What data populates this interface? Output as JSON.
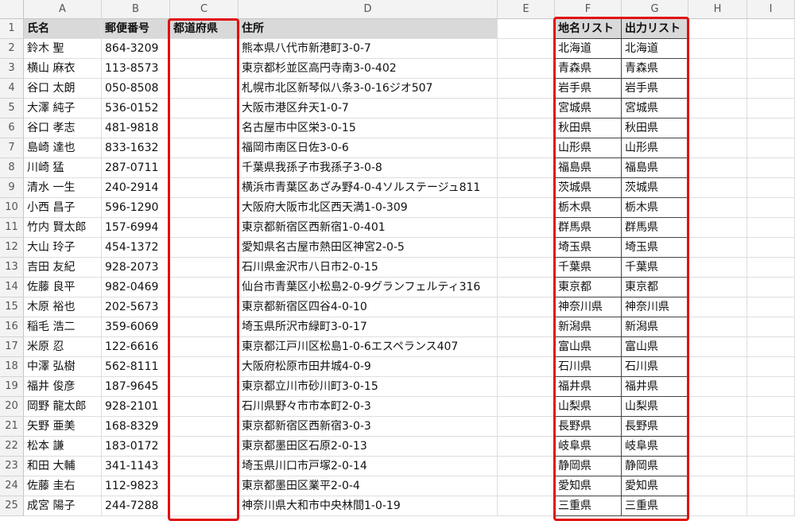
{
  "columns": [
    "A",
    "B",
    "C",
    "D",
    "E",
    "F",
    "G",
    "H",
    "I"
  ],
  "headers": {
    "name": "氏名",
    "postal": "郵便番号",
    "prefecture": "都道府県",
    "address": "住所",
    "place_list": "地名リスト",
    "output_list": "出力リスト"
  },
  "rows": [
    {
      "n": "2",
      "name": "鈴木 聖",
      "postal": "864-3209",
      "address": "熊本県八代市新港町3-0-7",
      "place": "北海道",
      "output": "北海道"
    },
    {
      "n": "3",
      "name": "横山 麻衣",
      "postal": "113-8573",
      "address": "東京都杉並区高円寺南3-0-402",
      "place": "青森県",
      "output": "青森県"
    },
    {
      "n": "4",
      "name": "谷口 太朗",
      "postal": "050-8508",
      "address": "札幌市北区新琴似八条3-0-16ジオ507",
      "place": "岩手県",
      "output": "岩手県"
    },
    {
      "n": "5",
      "name": "大澤 純子",
      "postal": "536-0152",
      "address": "大阪市港区弁天1-0-7",
      "place": "宮城県",
      "output": "宮城県"
    },
    {
      "n": "6",
      "name": "谷口 孝志",
      "postal": "481-9818",
      "address": "名古屋市中区栄3-0-15",
      "place": "秋田県",
      "output": "秋田県"
    },
    {
      "n": "7",
      "name": "島崎 達也",
      "postal": "833-1632",
      "address": "福岡市南区日佐3-0-6",
      "place": "山形県",
      "output": "山形県"
    },
    {
      "n": "8",
      "name": "川崎 猛",
      "postal": "287-0711",
      "address": "千葉県我孫子市我孫子3-0-8",
      "place": "福島県",
      "output": "福島県"
    },
    {
      "n": "9",
      "name": "清水 一生",
      "postal": "240-2914",
      "address": "横浜市青葉区あざみ野4-0-4ソルステージュ811",
      "place": "茨城県",
      "output": "茨城県"
    },
    {
      "n": "10",
      "name": "小西 昌子",
      "postal": "596-1290",
      "address": "大阪府大阪市北区西天満1-0-309",
      "place": "栃木県",
      "output": "栃木県"
    },
    {
      "n": "11",
      "name": "竹内 賢太郎",
      "postal": "157-6994",
      "address": "東京都新宿区西新宿1-0-401",
      "place": "群馬県",
      "output": "群馬県"
    },
    {
      "n": "12",
      "name": "大山 玲子",
      "postal": "454-1372",
      "address": "愛知県名古屋市熱田区神宮2-0-5",
      "place": "埼玉県",
      "output": "埼玉県"
    },
    {
      "n": "13",
      "name": "吉田 友紀",
      "postal": "928-2073",
      "address": "石川県金沢市八日市2-0-15",
      "place": "千葉県",
      "output": "千葉県"
    },
    {
      "n": "14",
      "name": "佐藤 良平",
      "postal": "982-0469",
      "address": "仙台市青葉区小松島2-0-9グランフェルティ316",
      "place": "東京都",
      "output": "東京都"
    },
    {
      "n": "15",
      "name": "木原 裕也",
      "postal": "202-5673",
      "address": "東京都新宿区四谷4-0-10",
      "place": "神奈川県",
      "output": "神奈川県"
    },
    {
      "n": "16",
      "name": "稲毛 浩二",
      "postal": "359-6069",
      "address": "埼玉県所沢市緑町3-0-17",
      "place": "新潟県",
      "output": "新潟県"
    },
    {
      "n": "17",
      "name": "米原 忍",
      "postal": "122-6616",
      "address": "東京都江戸川区松島1-0-6エスペランス407",
      "place": "富山県",
      "output": "富山県"
    },
    {
      "n": "18",
      "name": "中澤 弘樹",
      "postal": "562-8111",
      "address": "大阪府松原市田井城4-0-9",
      "place": "石川県",
      "output": "石川県"
    },
    {
      "n": "19",
      "name": "福井 俊彦",
      "postal": "187-9645",
      "address": "東京都立川市砂川町3-0-15",
      "place": "福井県",
      "output": "福井県"
    },
    {
      "n": "20",
      "name": "岡野 龍太郎",
      "postal": "928-2101",
      "address": "石川県野々市市本町2-0-3",
      "place": "山梨県",
      "output": "山梨県"
    },
    {
      "n": "21",
      "name": "矢野 亜美",
      "postal": "168-8329",
      "address": "東京都新宿区西新宿3-0-3",
      "place": "長野県",
      "output": "長野県"
    },
    {
      "n": "22",
      "name": "松本 謙",
      "postal": "183-0172",
      "address": "東京都墨田区石原2-0-13",
      "place": "岐阜県",
      "output": "岐阜県"
    },
    {
      "n": "23",
      "name": "和田 大輔",
      "postal": "341-1143",
      "address": "埼玉県川口市戸塚2-0-14",
      "place": "静岡県",
      "output": "静岡県"
    },
    {
      "n": "24",
      "name": "佐藤 圭右",
      "postal": "112-9823",
      "address": "東京都墨田区業平2-0-4",
      "place": "愛知県",
      "output": "愛知県"
    },
    {
      "n": "25",
      "name": "成宮 陽子",
      "postal": "244-7288",
      "address": "神奈川県大和市中央林間1-0-19",
      "place": "三重県",
      "output": "三重県"
    }
  ],
  "colors": {
    "highlight": "#e01010",
    "header_fill": "#d9d9d9"
  }
}
